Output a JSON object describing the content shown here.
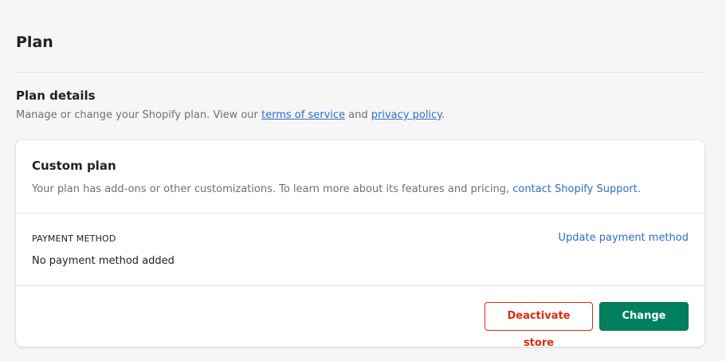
{
  "page": {
    "title": "Plan"
  },
  "plan_details": {
    "title": "Plan details",
    "desc_prefix": "Manage or change your Shopify plan. View our ",
    "terms_link": "terms of service",
    "desc_middle": " and ",
    "privacy_link": "privacy policy",
    "desc_suffix": "."
  },
  "card": {
    "title": "Custom plan",
    "desc_prefix": "Your plan has add-ons or other customizations. To learn more about its features and pricing, ",
    "support_link": "contact Shopify Support",
    "desc_suffix": ".",
    "payment": {
      "heading": "PAYMENT METHOD",
      "update_link": "Update payment method",
      "value": "No payment method added"
    },
    "actions": {
      "deactivate_label": "Deactivate store",
      "change_plan_label": "Change plan"
    }
  },
  "colors": {
    "link": "#2c6ecb",
    "critical": "#d82c0d",
    "primary": "#007f5f",
    "background": "#f6f6f7"
  }
}
